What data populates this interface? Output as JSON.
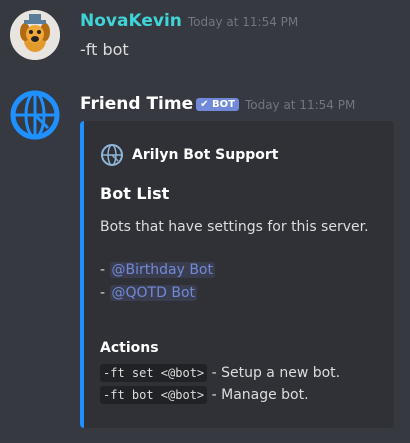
{
  "messages": [
    {
      "username": "NovaKevin",
      "username_color": "#3fd5d8",
      "timestamp": "Today at 11:54 PM",
      "content": "-ft bot"
    },
    {
      "username": "Friend Time",
      "username_color": "#ffffff",
      "bot_badge": "✔ BOT",
      "timestamp": "Today at 11:54 PM",
      "embed": {
        "accent_color": "#1e90ff",
        "author_icon": "globe-icon",
        "author_name": "Arilyn Bot Support",
        "title": "Bot List",
        "description": "Bots that have settings for this server.",
        "bots": [
          {
            "prefix": "-",
            "mention": "@Birthday Bot"
          },
          {
            "prefix": "-",
            "mention": "@QOTD Bot"
          }
        ],
        "field_name": "Actions",
        "actions": [
          {
            "command": "-ft set <@bot>",
            "description": "- Setup a new bot."
          },
          {
            "command": "-ft bot <@bot>",
            "description": "- Manage bot."
          }
        ]
      }
    }
  ]
}
